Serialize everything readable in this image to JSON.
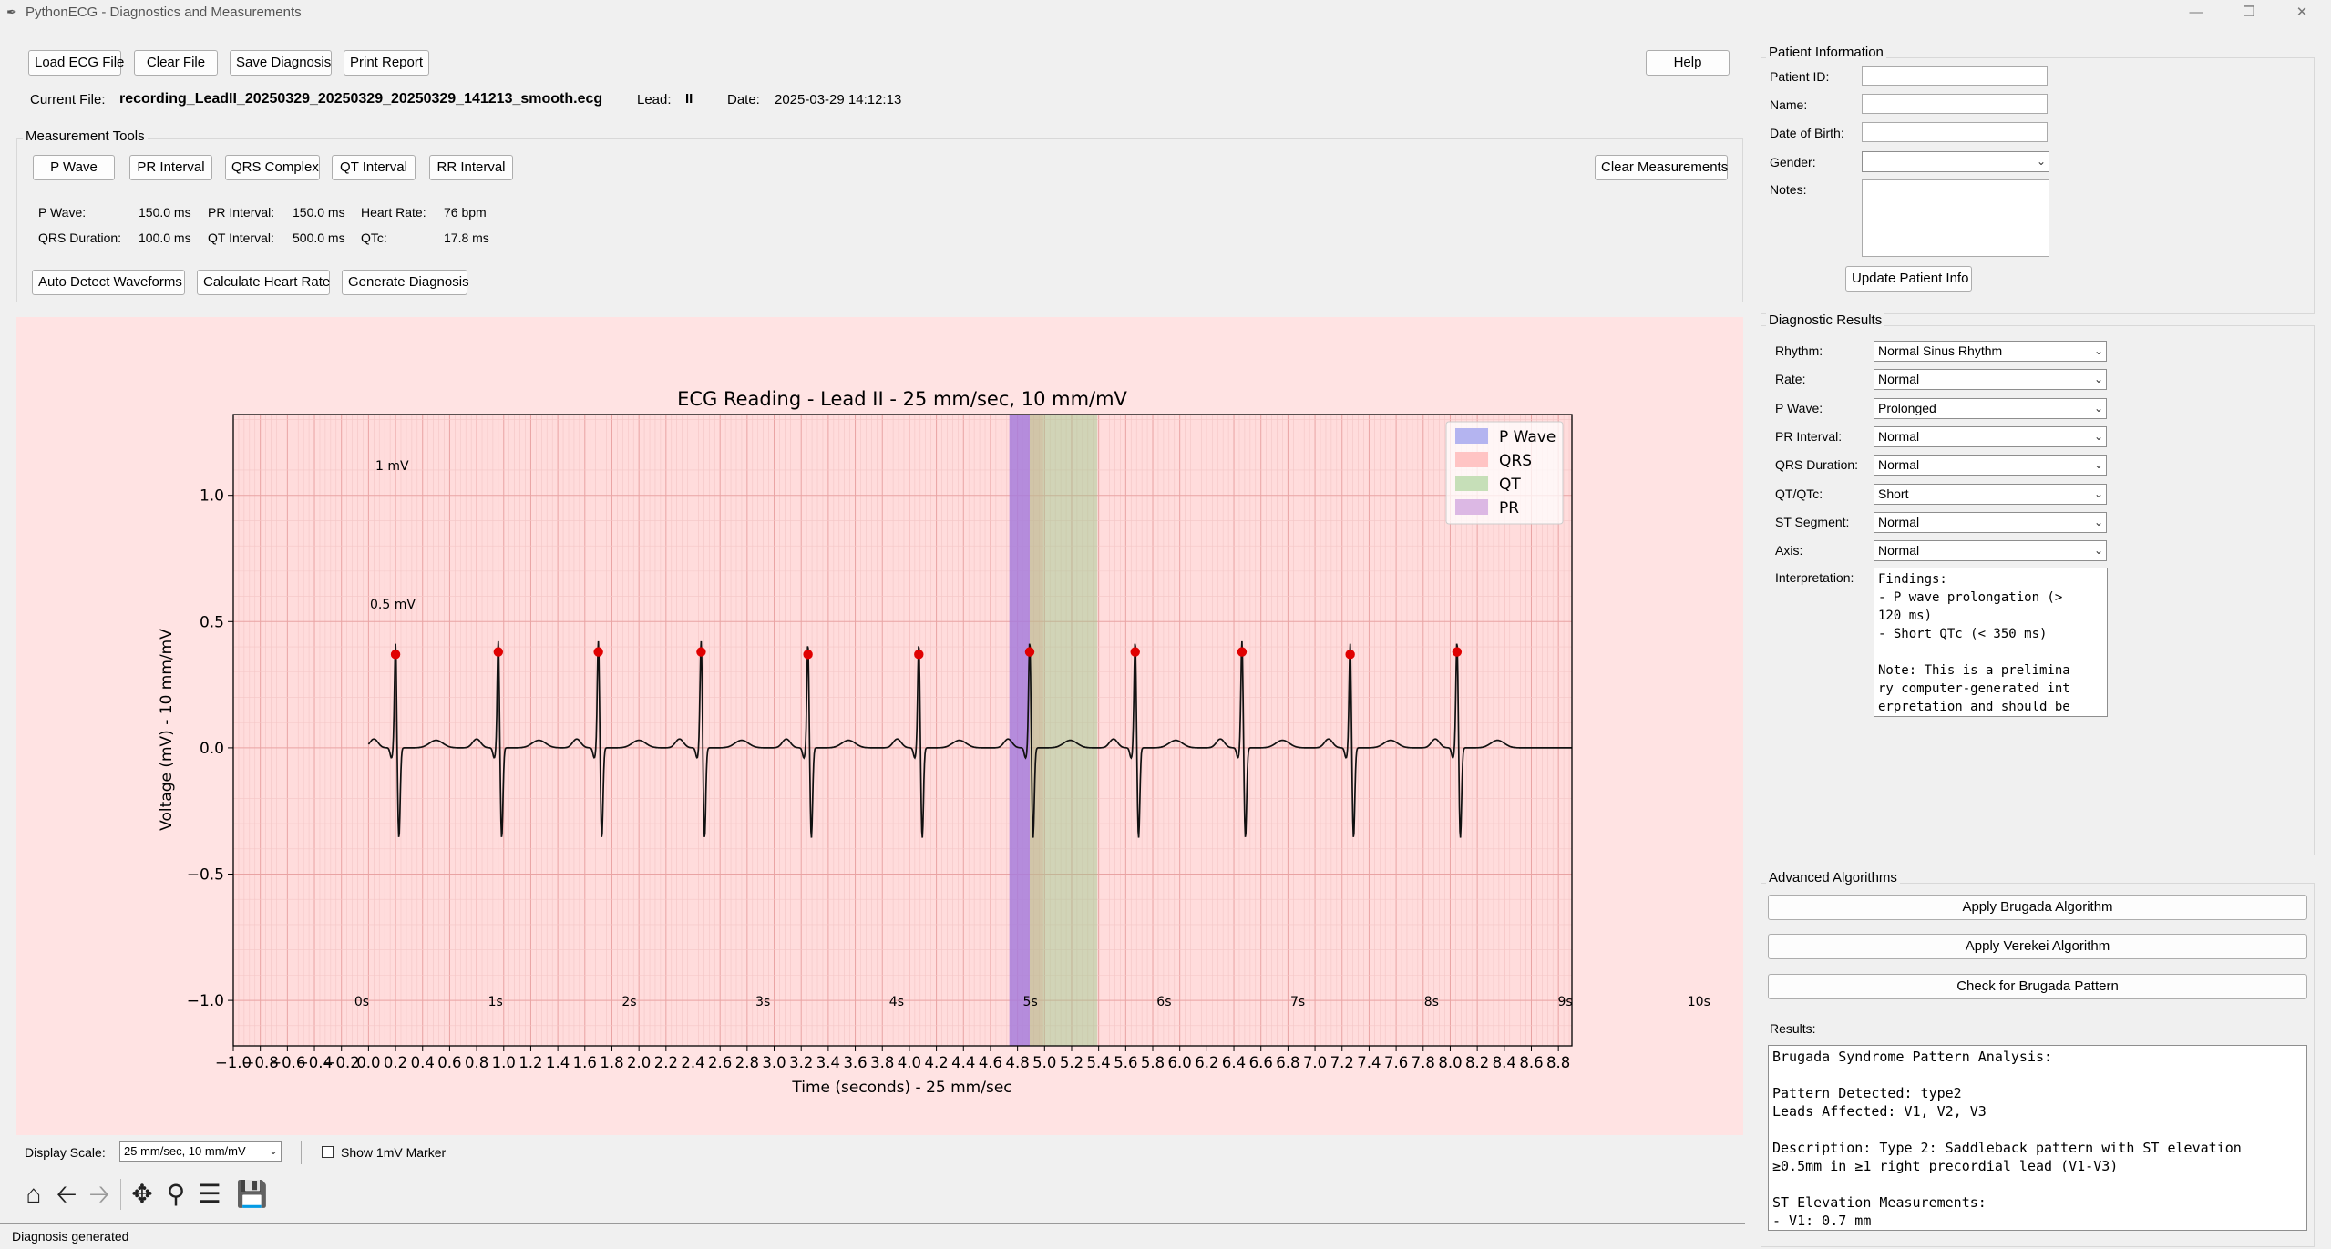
{
  "window": {
    "title": "PythonECG - Diagnostics and Measurements"
  },
  "toolbar": {
    "load": "Load ECG File",
    "clear": "Clear File",
    "save": "Save Diagnosis",
    "print": "Print Report",
    "help": "Help"
  },
  "file_info": {
    "current_file_label": "Current File:",
    "current_file": "recording_LeadII_20250329_20250329_20250329_141213_smooth.ecg",
    "lead_label": "Lead:",
    "lead": "II",
    "date_label": "Date:",
    "date": "2025-03-29 14:12:13"
  },
  "measurement_tools": {
    "title": "Measurement Tools",
    "buttons": [
      "P Wave",
      "PR Interval",
      "QRS Complex",
      "QT Interval",
      "RR Interval"
    ],
    "clear": "Clear Measurements",
    "values": [
      {
        "label": "P Wave:",
        "value": "150.0 ms"
      },
      {
        "label": "PR Interval:",
        "value": "150.0 ms"
      },
      {
        "label": "Heart Rate:",
        "value": "76 bpm"
      },
      {
        "label": "QRS Duration:",
        "value": "100.0 ms"
      },
      {
        "label": "QT Interval:",
        "value": "500.0 ms"
      },
      {
        "label": "QTc:",
        "value": "17.8 ms"
      }
    ],
    "actions": [
      "Auto Detect Waveforms",
      "Calculate Heart Rate",
      "Generate Diagnosis"
    ]
  },
  "chart_data": {
    "type": "line",
    "title": "ECG Reading - Lead II - 25 mm/sec, 10 mm/mV",
    "xlabel": "Time (seconds) - 25 mm/sec",
    "ylabel": "Voltage (mV) - 10 mm/mV",
    "xlim": [
      -1.0,
      8.9
    ],
    "ylim": [
      -1.18,
      1.32
    ],
    "x_tick_labels": [
      "-1.0",
      "-0.8",
      "-0.6",
      "-0.4",
      "-0.2",
      "0.0",
      "0.2",
      "0.4",
      "0.6",
      "0.8",
      "1.0",
      "1.2",
      "1.4",
      "1.6",
      "1.8",
      "2.0",
      "2.2",
      "2.4",
      "2.6",
      "2.8",
      "3.0",
      "3.2",
      "3.4",
      "3.6",
      "3.8",
      "4.0",
      "4.2",
      "4.4",
      "4.6",
      "4.8",
      "5.0",
      "5.2",
      "5.4",
      "5.6",
      "5.8",
      "6.0",
      "6.2",
      "6.4",
      "6.6",
      "6.8",
      "7.0",
      "7.2",
      "7.4",
      "7.6",
      "7.8",
      "8.0",
      "8.2",
      "8.4",
      "8.6",
      "8.8"
    ],
    "y_ticks": [
      -1.0,
      -0.5,
      0.0,
      0.5,
      1.0
    ],
    "y_tick_labels": [
      "−1.0",
      "−0.5",
      "0.0",
      "0.5",
      "1.0"
    ],
    "r_peaks": {
      "name": "R peaks",
      "x": [
        0.2,
        0.96,
        1.7,
        2.46,
        3.25,
        4.07,
        4.89,
        5.67,
        6.46,
        7.26,
        8.05
      ],
      "y": [
        0.37,
        0.38,
        0.38,
        0.38,
        0.37,
        0.37,
        0.38,
        0.38,
        0.38,
        0.37,
        0.38
      ]
    },
    "baseline_range": [
      0.0,
      8.9
    ],
    "spans": [
      {
        "name": "P Wave",
        "color": "#9a6fe0",
        "alpha": 0.75,
        "range": [
          4.74,
          4.89
        ]
      },
      {
        "name": "QRS",
        "color": "#ff9a9a",
        "alpha": 0.4,
        "range": [
          4.89,
          4.99
        ]
      },
      {
        "name": "QT",
        "color": "#9ac98a",
        "alpha": 0.45,
        "range": [
          4.89,
          5.39
        ]
      },
      {
        "name": "PR",
        "color": "#b98ed6",
        "alpha": 0.35,
        "range": [
          4.74,
          4.89
        ]
      }
    ],
    "legend": {
      "placement": "top-right",
      "entries": [
        "P Wave",
        "QRS",
        "QT",
        "PR"
      ],
      "colors": [
        "#b4b4f0",
        "#ffc4c4",
        "#c6dfb8",
        "#dcb8e4"
      ]
    },
    "annotations": {
      "one_mv": "1 mV",
      "half_mv": "0.5 mV",
      "time_marks": [
        "0s",
        "1s",
        "2s",
        "3s",
        "4s",
        "5s",
        "6s",
        "7s",
        "8s",
        "9s",
        "10s"
      ]
    },
    "grid": true
  },
  "display": {
    "scale_label": "Display Scale:",
    "scale_value": "25 mm/sec, 10 mm/mV",
    "marker_label": "Show 1mV Marker"
  },
  "nav_toolbar": [
    "home-icon",
    "back-icon",
    "forward-icon",
    "pan-icon",
    "zoom-icon",
    "configure-icon",
    "save-icon"
  ],
  "status": "Diagnosis generated",
  "patient": {
    "title": "Patient Information",
    "fields": [
      "Patient ID:",
      "Name:",
      "Date of Birth:",
      "Gender:",
      "Notes:"
    ],
    "update": "Update Patient Info"
  },
  "diagnostic": {
    "title": "Diagnostic Results",
    "rows": [
      {
        "label": "Rhythm:",
        "value": "Normal Sinus Rhythm"
      },
      {
        "label": "Rate:",
        "value": "Normal"
      },
      {
        "label": "P Wave:",
        "value": "Prolonged"
      },
      {
        "label": "PR Interval:",
        "value": "Normal"
      },
      {
        "label": "QRS Duration:",
        "value": "Normal"
      },
      {
        "label": "QT/QTc:",
        "value": "Short"
      },
      {
        "label": "ST Segment:",
        "value": "Normal"
      },
      {
        "label": "Axis:",
        "value": "Normal"
      }
    ],
    "interpretation_label": "Interpretation:",
    "interpretation": "Findings:\n- P wave prolongation (>\n120 ms)\n- Short QTc (< 350 ms)\n\nNote: This is a prelimina\nry computer-generated int\nerpretation and should be"
  },
  "advanced": {
    "title": "Advanced Algorithms",
    "buttons": [
      "Apply Brugada Algorithm",
      "Apply Verekei Algorithm",
      "Check for Brugada Pattern"
    ],
    "results_label": "Results:",
    "results": "Brugada Syndrome Pattern Analysis:\n\nPattern Detected: type2\nLeads Affected: V1, V2, V3\n\nDescription: Type 2: Saddleback pattern with ST elevation\n≥0.5mm in ≥1 right precordial lead (V1-V3)\n\nST Elevation Measurements:\n- V1: 0.7 mm"
  }
}
